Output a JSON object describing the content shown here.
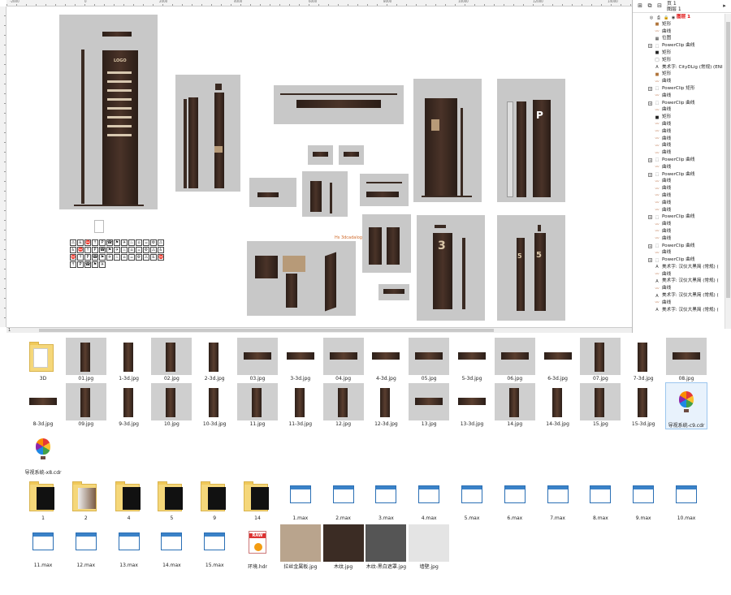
{
  "coreldraw": {
    "ruler_top_labels": [
      "-2000",
      "0",
      "2000",
      "4000",
      "6000",
      "8000",
      "10000",
      "12000",
      "14000"
    ],
    "canvas_note": "Hs 3dcadalog",
    "page_tab": "1",
    "sign_numbers": [
      "P",
      "3",
      "5",
      "5"
    ],
    "logo_text": "LOGO"
  },
  "object_manager": {
    "page_label": "页 1",
    "layer_header": "图层 1",
    "items": [
      {
        "level": "layer",
        "icon": "layer-icon",
        "label": "图层 1"
      },
      {
        "level": "obj",
        "icon": "rect-icon",
        "label": "矩形",
        "color": "#b0743a"
      },
      {
        "level": "obj",
        "icon": "curve-icon",
        "label": "曲线"
      },
      {
        "level": "obj",
        "icon": "bitmap-icon",
        "label": "位图"
      },
      {
        "level": "obj",
        "expand": true,
        "icon": "powerclip-icon",
        "label": "PowerClip 曲线"
      },
      {
        "level": "obj",
        "icon": "rect-icon",
        "label": "矩形",
        "color": "#222"
      },
      {
        "level": "obj",
        "icon": "rect-icon",
        "label": "矩形",
        "color": "#fff"
      },
      {
        "level": "obj",
        "icon": "text-icon",
        "label": "美术字: CityDLig (常规) (ENI"
      },
      {
        "level": "obj",
        "icon": "rect-icon",
        "label": "矩形",
        "color": "#b0743a"
      },
      {
        "level": "obj",
        "icon": "curve-icon",
        "label": "曲线"
      },
      {
        "level": "obj",
        "expand": true,
        "icon": "powerclip-icon",
        "label": "PowerClip 矩形"
      },
      {
        "level": "obj",
        "icon": "curve-icon",
        "label": "曲线"
      },
      {
        "level": "obj",
        "expand": true,
        "icon": "powerclip-icon",
        "label": "PowerClip 曲线"
      },
      {
        "level": "obj",
        "icon": "curve-icon",
        "label": "曲线"
      },
      {
        "level": "obj",
        "icon": "rect-icon",
        "label": "矩形",
        "color": "#222"
      },
      {
        "level": "obj",
        "icon": "curve-icon",
        "label": "曲线"
      },
      {
        "level": "obj",
        "icon": "curve-icon",
        "label": "曲线"
      },
      {
        "level": "obj",
        "icon": "curve-icon",
        "label": "曲线"
      },
      {
        "level": "obj",
        "icon": "curve-icon",
        "label": "曲线"
      },
      {
        "level": "obj",
        "icon": "curve-icon",
        "label": "曲线"
      },
      {
        "level": "obj",
        "expand": true,
        "icon": "powerclip-icon",
        "label": "PowerClip 曲线"
      },
      {
        "level": "obj",
        "icon": "curve-icon",
        "label": "曲线"
      },
      {
        "level": "obj",
        "expand": true,
        "icon": "powerclip-icon",
        "label": "PowerClip 曲线"
      },
      {
        "level": "obj",
        "icon": "curve-icon",
        "label": "曲线"
      },
      {
        "level": "obj",
        "icon": "curve-icon",
        "label": "曲线"
      },
      {
        "level": "obj",
        "icon": "curve-icon",
        "label": "曲线"
      },
      {
        "level": "obj",
        "icon": "curve-icon",
        "label": "曲线"
      },
      {
        "level": "obj",
        "icon": "curve-icon",
        "label": "曲线"
      },
      {
        "level": "obj",
        "expand": true,
        "icon": "powerclip-icon",
        "label": "PowerClip 曲线"
      },
      {
        "level": "obj",
        "icon": "curve-icon",
        "label": "曲线"
      },
      {
        "level": "obj",
        "icon": "curve-icon",
        "label": "曲线"
      },
      {
        "level": "obj",
        "icon": "curve-icon",
        "label": "曲线"
      },
      {
        "level": "obj",
        "expand": true,
        "icon": "powerclip-icon",
        "label": "PowerClip 曲线"
      },
      {
        "level": "obj",
        "icon": "curve-icon",
        "label": "曲线"
      },
      {
        "level": "obj",
        "expand": true,
        "icon": "powerclip-icon",
        "label": "PowerClip 曲线"
      },
      {
        "level": "obj",
        "icon": "text-icon",
        "label": "美术字: 汉仪大黑简 (常规) ("
      },
      {
        "level": "obj",
        "icon": "curve-icon",
        "label": "曲线"
      },
      {
        "level": "obj",
        "icon": "text-icon",
        "label": "美术字: 汉仪大黑简 (常规) ("
      },
      {
        "level": "obj",
        "icon": "curve-icon",
        "label": "曲线"
      },
      {
        "level": "obj",
        "icon": "text-icon",
        "label": "美术字: 汉仪大黑简 (常规) ("
      },
      {
        "level": "obj",
        "icon": "curve-icon",
        "label": "曲线"
      },
      {
        "level": "obj",
        "icon": "text-icon",
        "label": "美术字: 汉仪大黑简 (常规) ("
      }
    ]
  },
  "explorer": {
    "row1": [
      {
        "name": "3D",
        "kind": "folder"
      },
      {
        "name": "01.jpg",
        "kind": "img",
        "style": "tall"
      },
      {
        "name": "1-3d.jpg",
        "kind": "img",
        "style": "white-tall"
      },
      {
        "name": "02.jpg",
        "kind": "img",
        "style": "tall"
      },
      {
        "name": "2-3d.jpg",
        "kind": "img",
        "style": "white-tall"
      },
      {
        "name": "03.jpg",
        "kind": "img",
        "style": "wide"
      },
      {
        "name": "3-3d.jpg",
        "kind": "img",
        "style": "white-wide"
      },
      {
        "name": "04.jpg",
        "kind": "img",
        "style": "wide"
      },
      {
        "name": "4-3d.jpg",
        "kind": "img",
        "style": "white-wide"
      },
      {
        "name": "05.jpg",
        "kind": "img",
        "style": "wide"
      },
      {
        "name": "5-3d.jpg",
        "kind": "img",
        "style": "white-wide"
      },
      {
        "name": "06.jpg",
        "kind": "img",
        "style": "wide"
      },
      {
        "name": "6-3d.jpg",
        "kind": "img",
        "style": "white-wide"
      },
      {
        "name": "07.jpg",
        "kind": "img",
        "style": "tall"
      },
      {
        "name": "7-3d.jpg",
        "kind": "img",
        "style": "white-tall"
      },
      {
        "name": "08.jpg",
        "kind": "img",
        "style": "wide"
      }
    ],
    "row2": [
      {
        "name": "8-3d.jpg",
        "kind": "img",
        "style": "white-wide"
      },
      {
        "name": "09.jpg",
        "kind": "img",
        "style": "tall"
      },
      {
        "name": "9-3d.jpg",
        "kind": "img",
        "style": "white-tall"
      },
      {
        "name": "10.jpg",
        "kind": "img",
        "style": "tall"
      },
      {
        "name": "10-3d.jpg",
        "kind": "img",
        "style": "white-tall"
      },
      {
        "name": "11.jpg",
        "kind": "img",
        "style": "tall"
      },
      {
        "name": "11-3d.jpg",
        "kind": "img",
        "style": "white-tall"
      },
      {
        "name": "12.jpg",
        "kind": "img",
        "style": "tall"
      },
      {
        "name": "12-3d.jpg",
        "kind": "img",
        "style": "white-tall"
      },
      {
        "name": "13.jpg",
        "kind": "img",
        "style": "wide"
      },
      {
        "name": "13-3d.jpg",
        "kind": "img",
        "style": "white-wide"
      },
      {
        "name": "14.jpg",
        "kind": "img",
        "style": "tall"
      },
      {
        "name": "14-3d.jpg",
        "kind": "img",
        "style": "white-tall"
      },
      {
        "name": "15.jpg",
        "kind": "img",
        "style": "tall"
      },
      {
        "name": "15-3d.jpg",
        "kind": "img",
        "style": "white-tall"
      },
      {
        "name": "导视系统-c9.cdr",
        "kind": "cdr",
        "selected": true
      }
    ],
    "row3": [
      {
        "name": "导视系统-x8.cdr",
        "kind": "cdr"
      }
    ],
    "row4": [
      {
        "name": "1",
        "kind": "folder-dark"
      },
      {
        "name": "2",
        "kind": "folder-light"
      },
      {
        "name": "4",
        "kind": "folder-dark"
      },
      {
        "name": "5",
        "kind": "folder-dark"
      },
      {
        "name": "9",
        "kind": "folder-dark"
      },
      {
        "name": "14",
        "kind": "folder-dark"
      },
      {
        "name": "1.max",
        "kind": "max"
      },
      {
        "name": "2.max",
        "kind": "max"
      },
      {
        "name": "3.max",
        "kind": "max"
      },
      {
        "name": "4.max",
        "kind": "max"
      },
      {
        "name": "5.max",
        "kind": "max"
      },
      {
        "name": "6.max",
        "kind": "max"
      },
      {
        "name": "7.max",
        "kind": "max"
      },
      {
        "name": "8.max",
        "kind": "max"
      },
      {
        "name": "9.max",
        "kind": "max"
      },
      {
        "name": "10.max",
        "kind": "max"
      }
    ],
    "row5": [
      {
        "name": "11.max",
        "kind": "max"
      },
      {
        "name": "12.max",
        "kind": "max"
      },
      {
        "name": "13.max",
        "kind": "max"
      },
      {
        "name": "14.max",
        "kind": "max"
      },
      {
        "name": "15.max",
        "kind": "max"
      },
      {
        "name": "环境.hdr",
        "kind": "hdr"
      },
      {
        "name": "拉丝金属板.jpg",
        "kind": "tex",
        "color": "#b9a48d"
      },
      {
        "name": "木纹.jpg",
        "kind": "tex",
        "color": "#3b2c24"
      },
      {
        "name": "木纹-黑白遮罩.jpg",
        "kind": "tex",
        "color": "#555"
      },
      {
        "name": "墙壁.jpg",
        "kind": "tex",
        "color": "#e4e4e4"
      }
    ]
  }
}
